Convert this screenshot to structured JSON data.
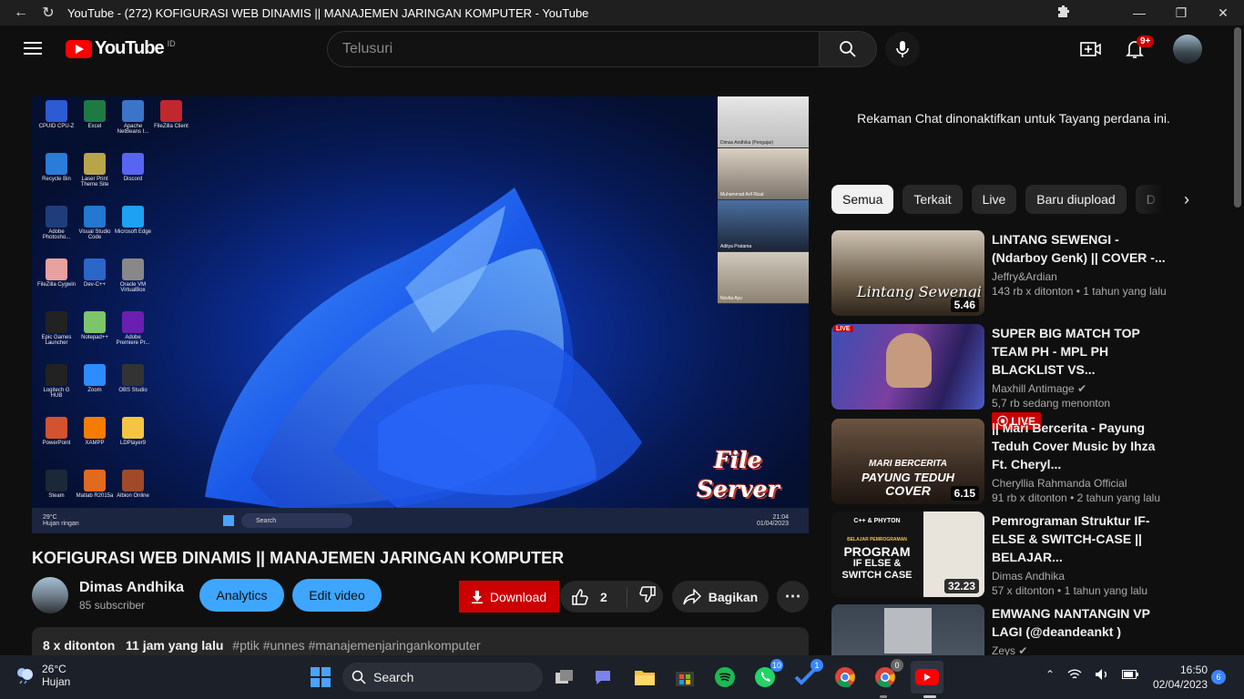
{
  "browser": {
    "tab_title": "YouTube - (272) KOFIGURASI WEB DINAMIS || MANAJEMEN JARINGAN KOMPUTER - YouTube"
  },
  "header": {
    "logo_text": "YouTube",
    "country_code": "ID",
    "search_placeholder": "Telusuri",
    "notification_count": "9+"
  },
  "video": {
    "overlay_text_line1": "File",
    "overlay_text_line2": "Server",
    "inner_weather_temp": "29°C",
    "inner_weather_text": "Hujan ringan",
    "inner_search": "Search",
    "inner_time": "21:04",
    "inner_date": "01/04/2023",
    "desktop_icons": [
      "CPUID CPU-Z",
      "Excel",
      "Apache NetBeans I...",
      "FileZilla Client",
      "Recycle Bin",
      "Laser Print Theme Site",
      "Discord",
      "",
      "Adobe Photosho...",
      "Visual Studio Code",
      "Microsoft Edge",
      "",
      "FileZilla Cygwin",
      "Dev-C++",
      "Oracle VM VirtualBox",
      "",
      "Epic Games Launcher",
      "Notepad++",
      "Adobe Premiere Pr...",
      "",
      "Logitech G HUB",
      "Zoom",
      "OBS Studio",
      "",
      "PowerPoint",
      "XAMPP",
      "LDPlayer9",
      "",
      "Steam",
      "Matlab R2015a",
      "Albion Online",
      ""
    ],
    "participants": [
      "Dimas Andhika (Pengajar)",
      "Muhammad Arif Rizal",
      "Aditya Pratama",
      "Novita Ayu"
    ]
  },
  "title": "KOFIGURASI WEB DINAMIS || MANAJEMEN JARINGAN KOMPUTER",
  "channel": {
    "name": "Dimas Andhika",
    "subscribers": "85 subscriber"
  },
  "actions": {
    "analytics": "Analytics",
    "edit": "Edit video",
    "download": "Download",
    "likes": "2",
    "share": "Bagikan"
  },
  "description": {
    "views": "8 x ditonton",
    "time": "11 jam yang lalu",
    "tags": "#ptik #unnes #manajemenjaringankomputer"
  },
  "chat_note": "Rekaman Chat dinonaktifkan untuk Tayang perdana ini.",
  "chips": [
    "Semua",
    "Terkait",
    "Live",
    "Baru diupload",
    "D"
  ],
  "recommendations": [
    {
      "title": "LINTANG SEWENGI - (Ndarboy Genk) || COVER -...",
      "channel": "Jeffry&Ardian",
      "views": "143 rb x ditonton",
      "age": "1 tahun yang lalu",
      "duration": "5.46",
      "thumb_text": "Lintang Sewengi",
      "verified": false,
      "live": false
    },
    {
      "title": "SUPER BIG MATCH TOP TEAM PH - MPL PH BLACKLIST VS...",
      "channel": "Maxhill Antimage",
      "views": "5,7 rb sedang menonton",
      "age": "",
      "duration": "",
      "thumb_text": "",
      "thumb_live": "LIVE",
      "live_badge": "LIVE",
      "verified": true,
      "live": true
    },
    {
      "title": "|| Mari Bercerita - Payung Teduh Cover Music by Ihza Ft. Cheryl...",
      "channel": "Cheryllia Rahmanda Official",
      "views": "91 rb x ditonton",
      "age": "2 tahun yang lalu",
      "duration": "6.15",
      "thumb_text_1": "MARI BERCERITA",
      "thumb_text_2": "PAYUNG TEDUH",
      "thumb_text_3": "COVER",
      "verified": false,
      "live": false
    },
    {
      "title": "Pemrograman Struktur IF-ELSE & SWITCH-CASE || BELAJAR...",
      "channel": "Dimas Andhika",
      "views": "57 x ditonton",
      "age": "1 tahun yang lalu",
      "duration": "32.23",
      "thumb_text_1": "C++ & PHYTON",
      "thumb_text_2": "BELAJAR PEMROGRAMAN",
      "thumb_text_3": "PROGRAM",
      "thumb_text_4": "IF ELSE &",
      "thumb_text_5": "SWITCH CASE",
      "verified": false,
      "live": false
    },
    {
      "title": "EMWANG NANTANGIN VP LAGI (@deandeankt )",
      "channel": "Zeys",
      "views": "",
      "age": "",
      "duration": "",
      "verified": true,
      "live": false
    }
  ],
  "taskbar": {
    "temperature": "26°C",
    "weather": "Hujan",
    "search": "Search",
    "whatsapp_badge": "10",
    "todo_badge": "1",
    "chrome2_badge": "0",
    "time": "16:50",
    "date": "02/04/2023",
    "notifications": "6"
  },
  "colors": {
    "background": "#0f0f0f",
    "accent_blue": "#3ea6ff",
    "brand_red": "#ff0000",
    "download_red": "#cc0000"
  }
}
